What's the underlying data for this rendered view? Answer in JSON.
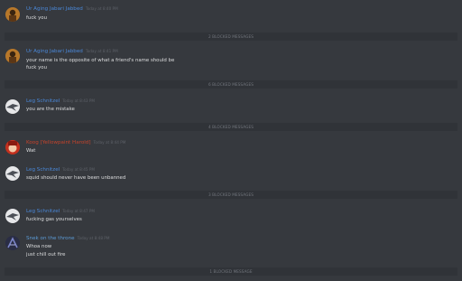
{
  "messages": [
    {
      "username": "Ur Aging Jabari Jabbed",
      "timestamp": "Today at 8:40 PM",
      "lines": [
        "fuck you"
      ],
      "name_color": "#4a88d9",
      "avatar": "orange-avatar-icon"
    },
    {
      "username": "Ur Aging Jabari Jabbed",
      "timestamp": "Today at 8:41 PM",
      "lines": [
        "your name is the opposite of what a friend's name should be",
        "fuck you"
      ],
      "name_color": "#4a88d9",
      "avatar": "orange-avatar-icon"
    },
    {
      "username": "Leg Schnitzel",
      "timestamp": "Today at 8:43 PM",
      "lines": [
        "you are the mistake"
      ],
      "name_color": "#4a88d9",
      "avatar": "bird-avatar-icon"
    },
    {
      "username": "Koog [Yellowpaint Harold]",
      "timestamp": "Today at 8:44 PM",
      "lines": [
        "Wat"
      ],
      "name_color": "#c6432b",
      "avatar": "red-avatar-icon"
    },
    {
      "username": "Leg Schnitzel",
      "timestamp": "Today at 8:45 PM",
      "lines": [
        "squid should never have been unbanned"
      ],
      "name_color": "#4a88d9",
      "avatar": "bird-avatar-icon"
    },
    {
      "username": "Leg Schnitzel",
      "timestamp": "Today at 8:47 PM",
      "lines": [
        "fucking gas yourselves"
      ],
      "name_color": "#4a88d9",
      "avatar": "bird-avatar-icon"
    },
    {
      "username": "Snek on the throne",
      "timestamp": "Today at 8:48 PM",
      "lines": [
        "Whoa now",
        "just chill out fire"
      ],
      "name_color": "#5c9bd6",
      "avatar": "snake-avatar-icon"
    }
  ],
  "blocked": [
    "2 BLOCKED MESSAGES",
    "6 BLOCKED MESSAGES",
    "4 BLOCKED MESSAGES",
    "3 BLOCKED MESSAGES",
    "1 BLOCKED MESSAGE"
  ],
  "colors": {
    "background": "#36393e",
    "blocked_bar": "#303338",
    "text": "#dcddde",
    "muted": "#72767d"
  }
}
